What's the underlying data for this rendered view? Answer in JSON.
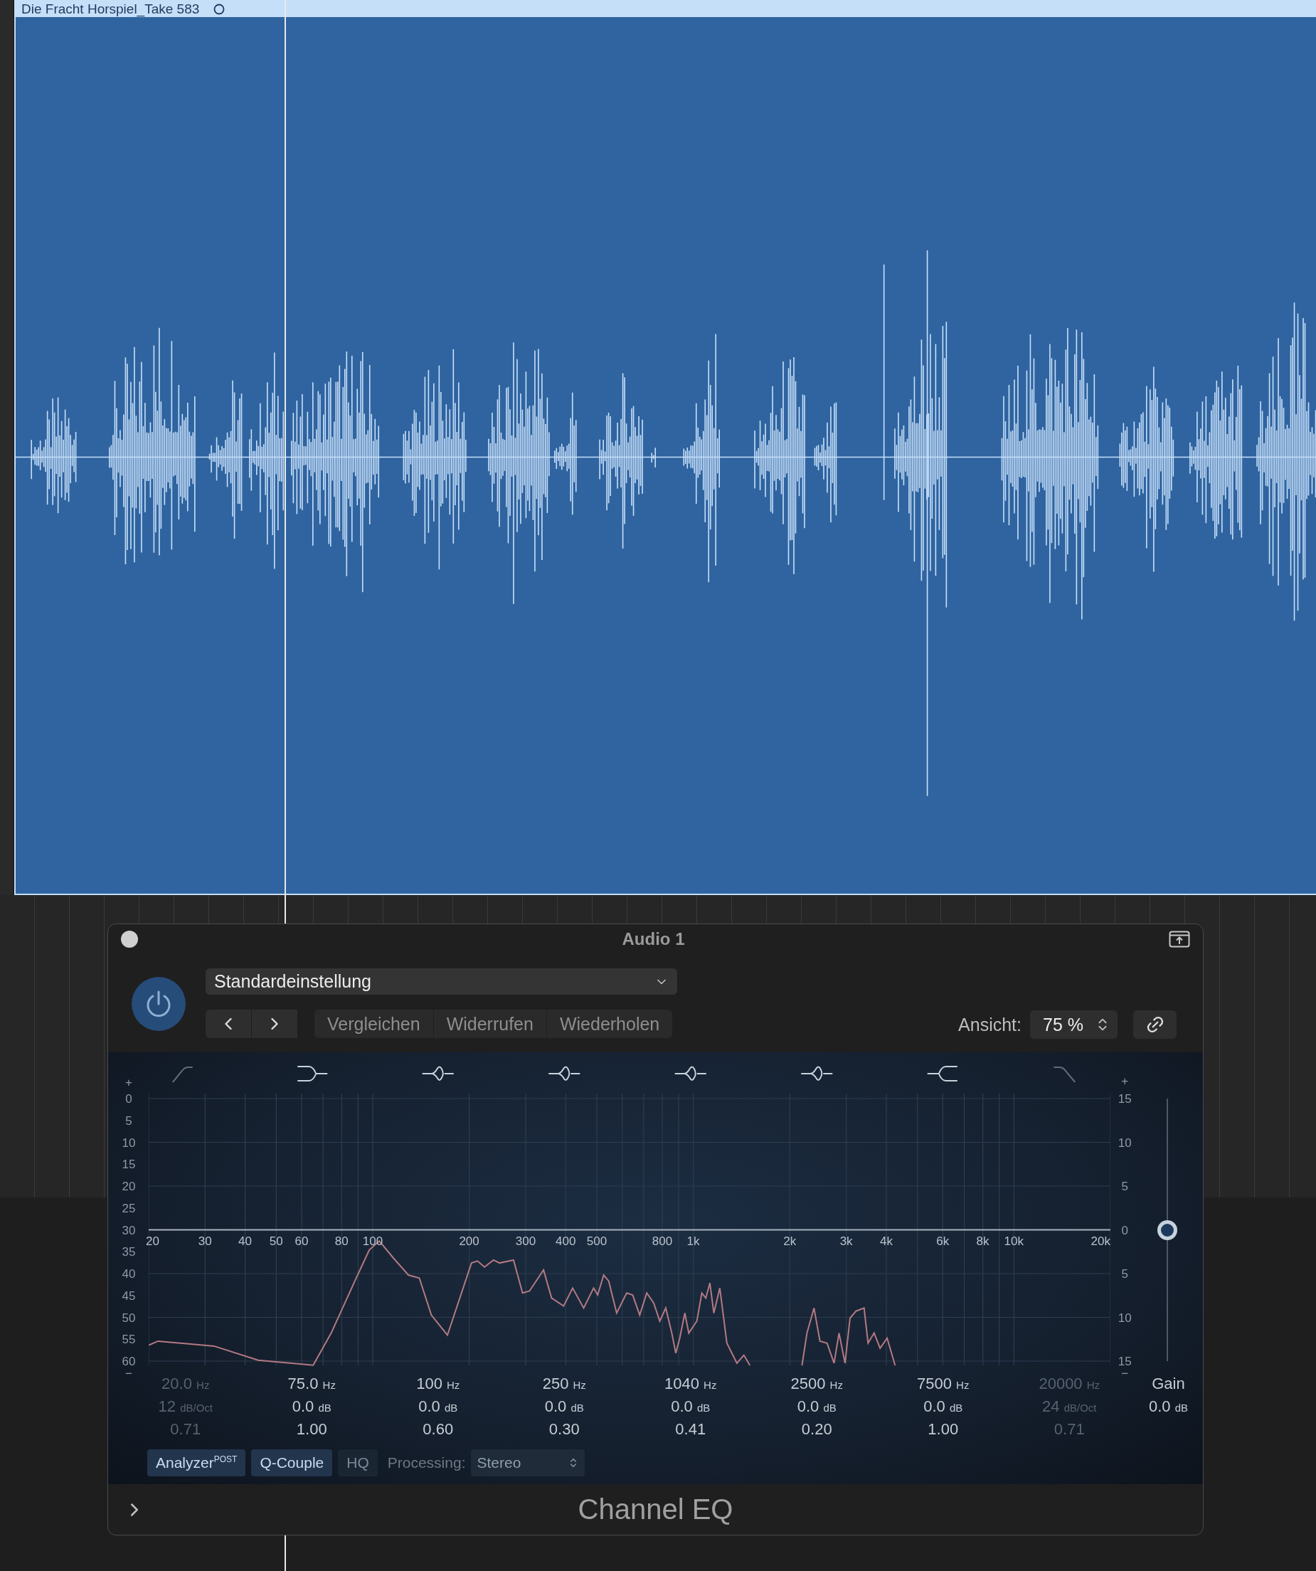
{
  "region": {
    "title": "Die Fracht Horspiel_Take 583"
  },
  "plugin": {
    "title": "Audio 1",
    "power_on": true,
    "preset": "Standardeinstellung",
    "actions": [
      "Vergleichen",
      "Widerrufen",
      "Wiederholen"
    ],
    "view_label": "Ansicht:",
    "view_value": "75 %"
  },
  "graph": {
    "left_scale": [
      "+",
      "0",
      "5",
      "10",
      "15",
      "20",
      "25",
      "30",
      "35",
      "40",
      "45",
      "50",
      "55",
      "60",
      "−"
    ],
    "right_scale": [
      "+",
      "15",
      "10",
      "5",
      "0",
      "5",
      "10",
      "15",
      "−"
    ],
    "freq_labels": [
      "20",
      "30",
      "40",
      "50",
      "60",
      "80",
      "100",
      "200",
      "300",
      "400",
      "500",
      "800",
      "1k",
      "2k",
      "3k",
      "4k",
      "6k",
      "8k",
      "10k",
      "20k"
    ]
  },
  "bands": [
    {
      "kind": "lowcut",
      "on": false,
      "freq": "20.0",
      "freq_unit": "Hz",
      "gain": "12",
      "gain_unit": "dB/Oct",
      "q": "0.71"
    },
    {
      "kind": "lowshelf",
      "on": true,
      "freq": "75.0",
      "freq_unit": "Hz",
      "gain": "0.0",
      "gain_unit": "dB",
      "q": "1.00"
    },
    {
      "kind": "peak",
      "on": true,
      "freq": "100",
      "freq_unit": "Hz",
      "gain": "0.0",
      "gain_unit": "dB",
      "q": "0.60"
    },
    {
      "kind": "peak",
      "on": true,
      "freq": "250",
      "freq_unit": "Hz",
      "gain": "0.0",
      "gain_unit": "dB",
      "q": "0.30"
    },
    {
      "kind": "peak",
      "on": true,
      "freq": "1040",
      "freq_unit": "Hz",
      "gain": "0.0",
      "gain_unit": "dB",
      "q": "0.41"
    },
    {
      "kind": "peak",
      "on": true,
      "freq": "2500",
      "freq_unit": "Hz",
      "gain": "0.0",
      "gain_unit": "dB",
      "q": "0.20"
    },
    {
      "kind": "highshelf",
      "on": true,
      "freq": "7500",
      "freq_unit": "Hz",
      "gain": "0.0",
      "gain_unit": "dB",
      "q": "1.00"
    },
    {
      "kind": "highcut",
      "on": false,
      "freq": "20000",
      "freq_unit": "Hz",
      "gain": "24",
      "gain_unit": "dB/Oct",
      "q": "0.71"
    }
  ],
  "gain": {
    "label": "Gain",
    "value": "0.0",
    "unit": "dB",
    "level": 0.5
  },
  "options": [
    {
      "label": "Analyzer",
      "sup": "POST",
      "selected": true
    },
    {
      "label": "Q-Couple",
      "selected": true
    },
    {
      "label": "HQ",
      "selected": false
    }
  ],
  "processing": {
    "label": "Processing:",
    "value": "Stereo"
  },
  "plugin_name": "Channel EQ"
}
